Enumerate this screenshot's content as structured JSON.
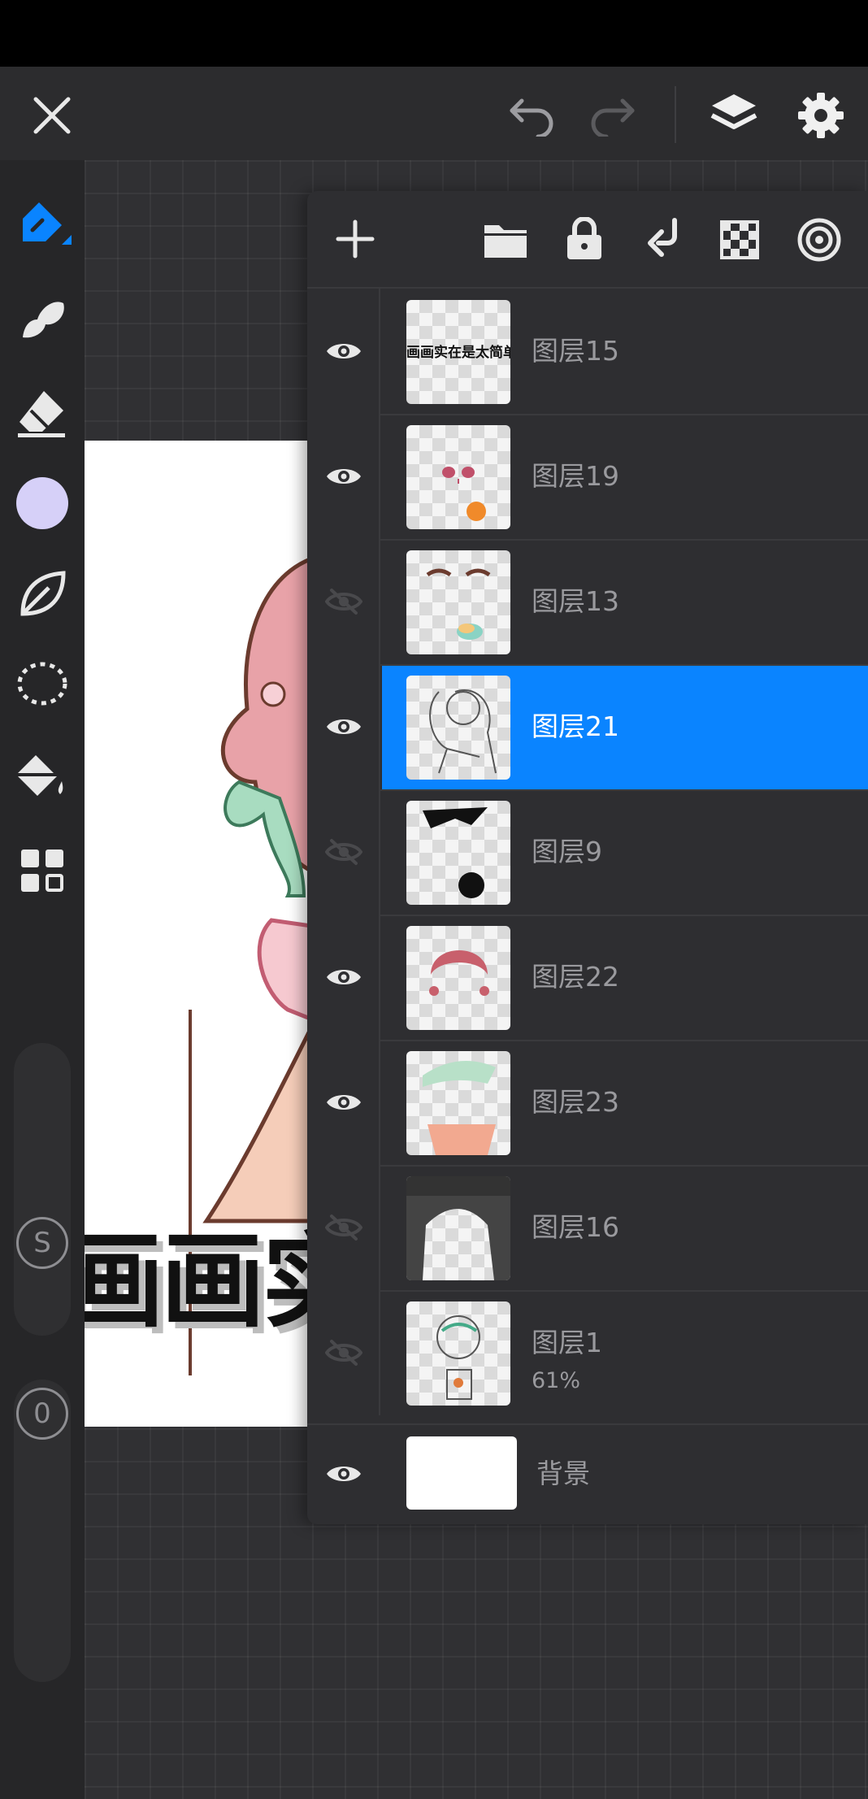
{
  "app": {
    "accent_color": "#0a84ff",
    "current_color": "#d6d0f8"
  },
  "top_toolbar": {
    "icons": [
      "close-icon",
      "undo-icon",
      "redo-icon",
      "layers-icon",
      "gear-icon"
    ]
  },
  "left_toolbar": {
    "tools": [
      "brush-icon",
      "smudge-icon",
      "eraser-icon",
      "color-swatch",
      "leaf-shape-icon",
      "lasso-select-icon",
      "paint-bucket-icon",
      "grid-apps-icon"
    ],
    "size_badge": "S",
    "opacity_badge": "0"
  },
  "layers_panel": {
    "toolbar_icons": [
      "plus-icon",
      "folder-icon",
      "lock-icon",
      "merge-down-icon",
      "transparency-checker-icon",
      "target-icon"
    ],
    "layers": [
      {
        "name": "图层15",
        "visible": true,
        "selected": false,
        "opacity": ""
      },
      {
        "name": "图层19",
        "visible": true,
        "selected": false,
        "opacity": ""
      },
      {
        "name": "图层13",
        "visible": false,
        "selected": false,
        "opacity": ""
      },
      {
        "name": "图层21",
        "visible": true,
        "selected": true,
        "opacity": ""
      },
      {
        "name": "图层9",
        "visible": false,
        "selected": false,
        "opacity": ""
      },
      {
        "name": "图层22",
        "visible": true,
        "selected": false,
        "opacity": ""
      },
      {
        "name": "图层23",
        "visible": true,
        "selected": false,
        "opacity": ""
      },
      {
        "name": "图层16",
        "visible": false,
        "selected": false,
        "opacity": ""
      },
      {
        "name": "图层1",
        "visible": false,
        "selected": false,
        "opacity": "61%"
      }
    ],
    "background_layer": {
      "name": "背景",
      "visible": true
    },
    "thumbnail_texts": {
      "layer15": "画画实在是太简单啦!"
    }
  },
  "canvas": {
    "artwork_text": "画画实"
  }
}
